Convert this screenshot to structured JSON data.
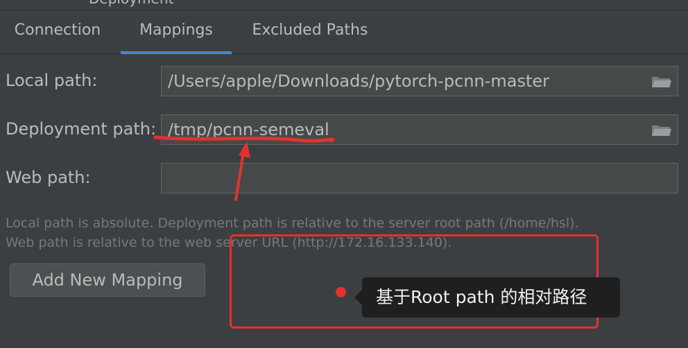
{
  "window": {
    "title": "Deployment"
  },
  "tabs": [
    {
      "label": "Connection"
    },
    {
      "label": "Mappings"
    },
    {
      "label": "Excluded Paths"
    }
  ],
  "form": {
    "local_path_label": "Local path:",
    "local_path_value": "/Users/apple/Downloads/pytorch-pcnn-master",
    "deployment_path_label": "Deployment path:",
    "deployment_path_value": "/tmp/pcnn-semeval",
    "web_path_label": "Web path:",
    "web_path_value": ""
  },
  "hints": {
    "line1": "Local path is absolute. Deployment path is relative to the server root path (/home/hsl).",
    "line2": "Web path is relative to the web server URL (http://172.16.133.140)."
  },
  "buttons": {
    "add_mapping": "Add New Mapping"
  },
  "annotation": {
    "tooltip": "基于Root path 的相对路径",
    "color": "#e5312c"
  },
  "icons": [
    "folder-icon"
  ]
}
